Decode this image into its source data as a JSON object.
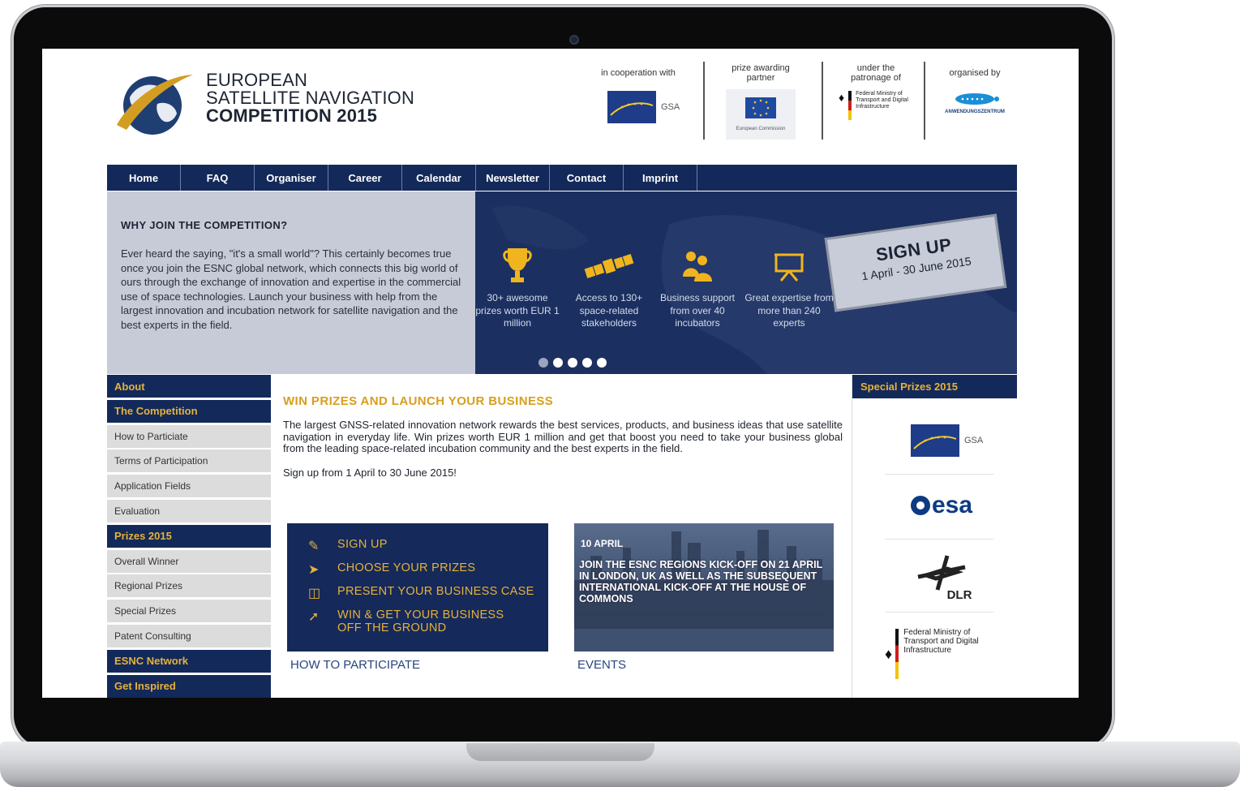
{
  "header": {
    "title_line1": "EUROPEAN",
    "title_line2": "SATELLITE NAVIGATION",
    "title_line3": "COMPETITION 2015",
    "partners": [
      {
        "label": "in cooperation with",
        "logo": "gsa-logo"
      },
      {
        "label": "prize awarding partner",
        "logo": "european-commission-logo"
      },
      {
        "label": "under the patronage of",
        "logo": "federal-ministry-logo"
      },
      {
        "label": "organised by",
        "logo": "anwendungszentrum-logo"
      }
    ],
    "ministry_small": "Federal Ministry of Transport and Digital Infrastructure",
    "ec_small": "European Commission",
    "az_small": "ANWENDUNGSZENTRUM"
  },
  "nav": [
    "Home",
    "FAQ",
    "Organiser",
    "Career",
    "Calendar",
    "Newsletter",
    "Contact",
    "Imprint"
  ],
  "banner": {
    "why_title": "WHY JOIN THE COMPETITION?",
    "why_body": "Ever heard the saying, \"it's a small world\"? This certainly becomes true once you join the ESNC global network, which connects this big world of ours through the exchange of innovation and expertise in the commercial use of space technologies. Launch your business with help from the largest innovation and incubation network for satellite navigation and the best experts in the field.",
    "features": [
      {
        "icon": "trophy-icon",
        "text": "30+ awesome prizes worth EUR 1 million"
      },
      {
        "icon": "satellite-icon",
        "text": "Access to 130+ space-related stakeholders"
      },
      {
        "icon": "people-icon",
        "text": "Business support from over 40 incubators"
      },
      {
        "icon": "presentation-icon",
        "text": "Great expertise from more than 240 experts"
      }
    ],
    "signup_title": "SIGN UP",
    "signup_dates": "1 April - 30 June 2015",
    "slide_count": 5,
    "active_slide": 1
  },
  "sidebar": [
    {
      "label": "About",
      "type": "head"
    },
    {
      "label": "The Competition",
      "type": "head"
    },
    {
      "label": "How to Particiate",
      "type": "item"
    },
    {
      "label": "Terms of Participation",
      "type": "item"
    },
    {
      "label": "Application Fields",
      "type": "item"
    },
    {
      "label": "Evaluation",
      "type": "item"
    },
    {
      "label": "Prizes 2015",
      "type": "head"
    },
    {
      "label": "Overall Winner",
      "type": "item"
    },
    {
      "label": "Regional Prizes",
      "type": "item"
    },
    {
      "label": "Special Prizes",
      "type": "item"
    },
    {
      "label": "Patent Consulting",
      "type": "item"
    },
    {
      "label": "ESNC Network",
      "type": "head"
    },
    {
      "label": "Get Inspired",
      "type": "head"
    }
  ],
  "content": {
    "title": "WIN PRIZES AND LAUNCH YOUR BUSINESS",
    "body": "The largest GNSS-related innovation network rewards the best services, products, and business ideas that use satellite navigation in everyday life. Win prizes worth EUR 1 million and get that boost you need to take your business global from the leading space-related incubation community and the best experts in the field.",
    "signup_line": "Sign up from 1 April to 30 June 2015!",
    "howto_steps": [
      {
        "icon": "edit-icon",
        "label": "SIGN UP"
      },
      {
        "icon": "pointer-icon",
        "label": "CHOOSE YOUR PRIZES"
      },
      {
        "icon": "presentation-icon",
        "label": "PRESENT YOUR BUSINESS CASE"
      },
      {
        "icon": "rocket-icon",
        "label": "WIN & GET YOUR BUSINESS OFF THE GROUND"
      }
    ],
    "howto_caption": "HOW TO PARTICIPATE",
    "events_date": "10 APRIL",
    "events_text": "JOIN THE ESNC REGIONS KICK-OFF ON 21 APRIL IN LONDON, UK AS WELL AS THE SUBSEQUENT INTERNATIONAL KICK-OFF AT THE HOUSE OF COMMONS",
    "events_caption": "EVENTS"
  },
  "right_column": {
    "title": "Special Prizes 2015",
    "logos": [
      {
        "name": "gsa-logo",
        "text": "GSA"
      },
      {
        "name": "esa-logo",
        "text": "esa"
      },
      {
        "name": "dlr-logo",
        "text": "DLR"
      },
      {
        "name": "federal-ministry-logo",
        "text": "Federal Ministry of Transport and Digital Infrastructure"
      }
    ]
  },
  "colors": {
    "navy": "#13295a",
    "gold": "#e6b23a",
    "banner_bg": "#1b3060",
    "sidebar_item": "#dcdcdc"
  }
}
